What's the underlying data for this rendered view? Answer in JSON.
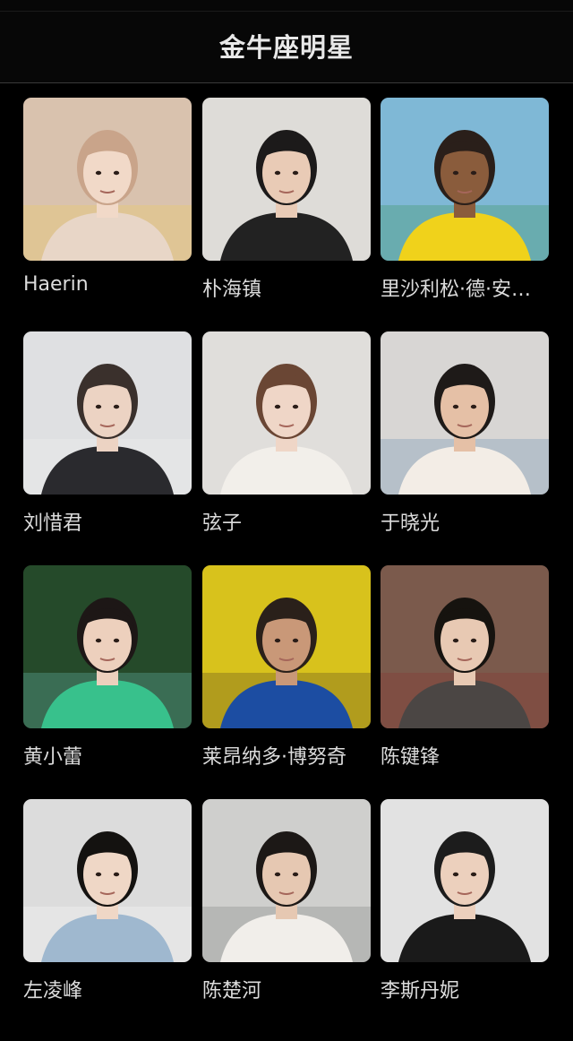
{
  "header": {
    "title": "金牛座明星"
  },
  "celebrities": [
    {
      "name": "Haerin",
      "bg": "#d9c2ae",
      "hair": "#c9a48a",
      "skin": "#f1d9c8",
      "shirt": "#e8d6c7",
      "accent": "#f2d14a"
    },
    {
      "name": "朴海镇",
      "bg": "#dedcd8",
      "hair": "#1c1a1a",
      "skin": "#e9cbb6",
      "shirt": "#222222",
      "accent": "#dedcd8"
    },
    {
      "name": "里沙利松·德·安…",
      "bg": "#7fb8d6",
      "hair": "#2a1f1a",
      "skin": "#8a5c3c",
      "shirt": "#f0d21b",
      "accent": "#27863c"
    },
    {
      "name": "刘惜君",
      "bg": "#dfe0e2",
      "hair": "#3a302c",
      "skin": "#ecd3c3",
      "shirt": "#2a2a2e",
      "accent": "#f2f2f2"
    },
    {
      "name": "弦子",
      "bg": "#e0dedb",
      "hair": "#6a4634",
      "skin": "#efd6c7",
      "shirt": "#f2efea",
      "accent": "#e0dedb"
    },
    {
      "name": "于晓光",
      "bg": "#d8d6d4",
      "hair": "#1e1a18",
      "skin": "#e5c0a6",
      "shirt": "#f3ede6",
      "accent": "#4f7fa8"
    },
    {
      "name": "黄小蕾",
      "bg": "#254a2a",
      "hair": "#1d1716",
      "skin": "#edd0bd",
      "shirt": "#38c18c",
      "accent": "#7ad8d2"
    },
    {
      "name": "莱昂纳多·博努奇",
      "bg": "#d8c21c",
      "hair": "#2a201a",
      "skin": "#c99878",
      "shirt": "#1c4da2",
      "accent": "#3c2a20"
    },
    {
      "name": "陈键锋",
      "bg": "#7b5a4c",
      "hair": "#16130f",
      "skin": "#e8c9b3",
      "shirt": "#4b4644",
      "accent": "#8a2a28"
    },
    {
      "name": "左凌峰",
      "bg": "#dcdcdc",
      "hair": "#141210",
      "skin": "#efd7c6",
      "shirt": "#9fb8cf",
      "accent": "#ffffff"
    },
    {
      "name": "陈楚河",
      "bg": "#cfcfcd",
      "hair": "#1c1816",
      "skin": "#e6c8b2",
      "shirt": "#f1eeea",
      "accent": "#6a6e70"
    },
    {
      "name": "李斯丹妮",
      "bg": "#e2e2e2",
      "hair": "#1c1c1c",
      "skin": "#ecd0bd",
      "shirt": "#1a1a1a",
      "accent": "#e2e2e2"
    }
  ]
}
